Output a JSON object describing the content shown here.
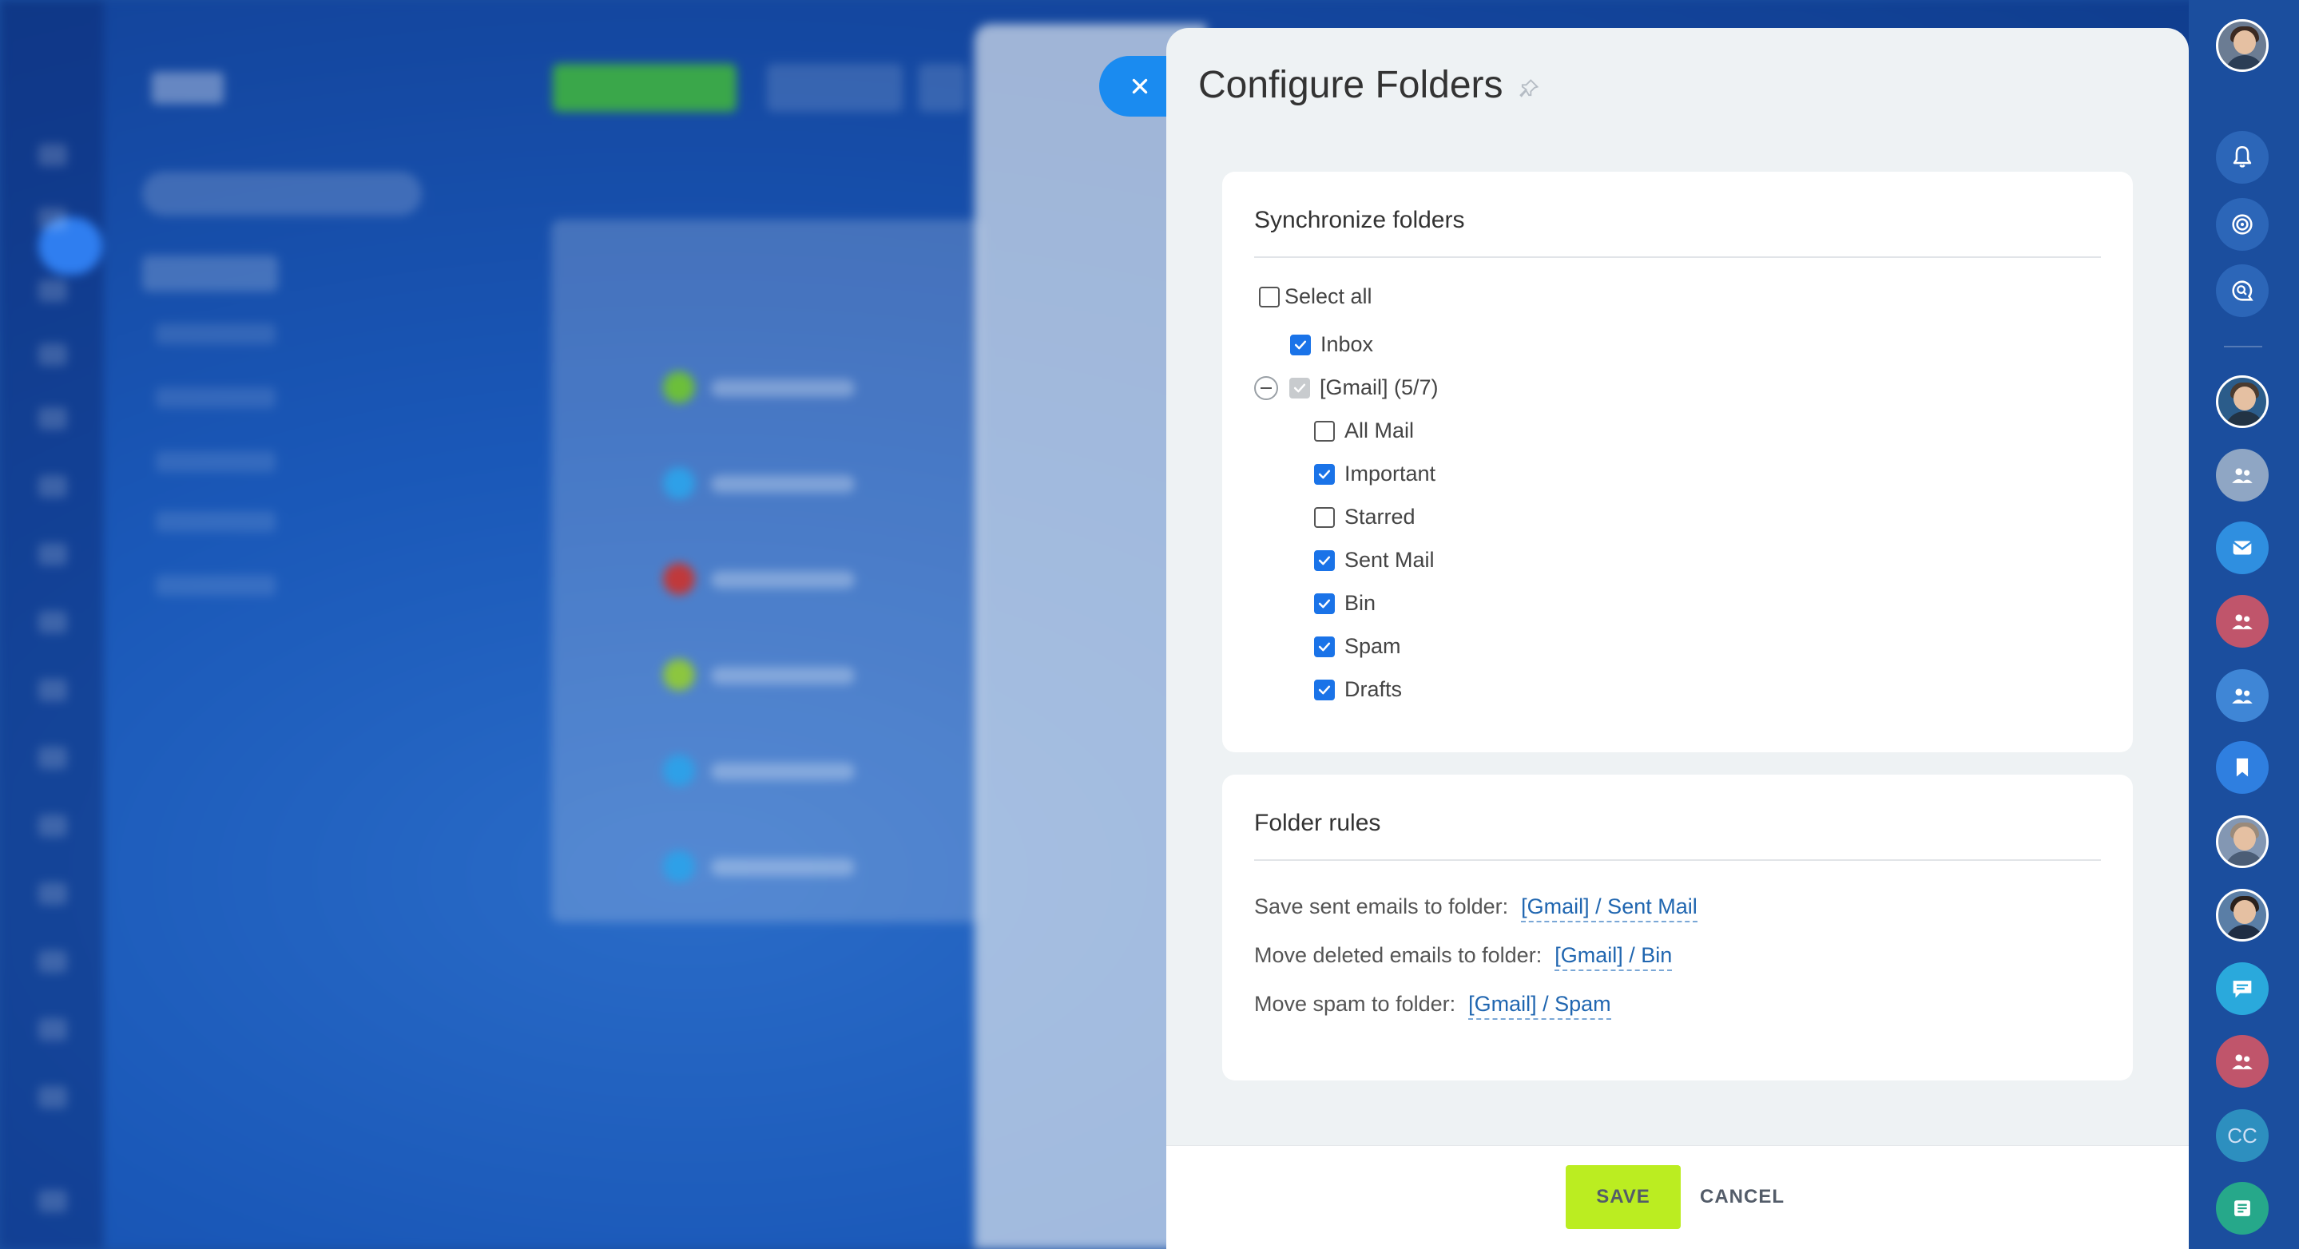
{
  "dialog": {
    "title": "Configure Folders",
    "sync_card": {
      "title": "Synchronize folders",
      "select_all": {
        "label": "Select all",
        "checked": false
      },
      "inbox": {
        "label": "Inbox",
        "checked": true
      },
      "gmail_group": {
        "label": "[Gmail] (5/7)",
        "checked": true,
        "disabled": true
      },
      "folders": [
        {
          "label": "All Mail",
          "checked": false
        },
        {
          "label": "Important",
          "checked": true
        },
        {
          "label": "Starred",
          "checked": false
        },
        {
          "label": "Sent Mail",
          "checked": true
        },
        {
          "label": "Bin",
          "checked": true
        },
        {
          "label": "Spam",
          "checked": true
        },
        {
          "label": "Drafts",
          "checked": true
        }
      ]
    },
    "rules_card": {
      "title": "Folder rules",
      "rules": [
        {
          "label": "Save sent emails to folder:",
          "value": "[Gmail] / Sent Mail"
        },
        {
          "label": "Move deleted emails to folder:",
          "value": "[Gmail] / Bin"
        },
        {
          "label": "Move spam to folder:",
          "value": "[Gmail] / Spam"
        }
      ]
    },
    "footer": {
      "save_label": "SAVE",
      "cancel_label": "CANCEL"
    }
  },
  "rightbar": {
    "cc_label": "CC"
  },
  "colors": {
    "accent_blue": "#1a73e8",
    "save_green": "#bbed21",
    "close_tab": "#1a8bf0",
    "sidebar_bg": "#1b4e9e"
  }
}
